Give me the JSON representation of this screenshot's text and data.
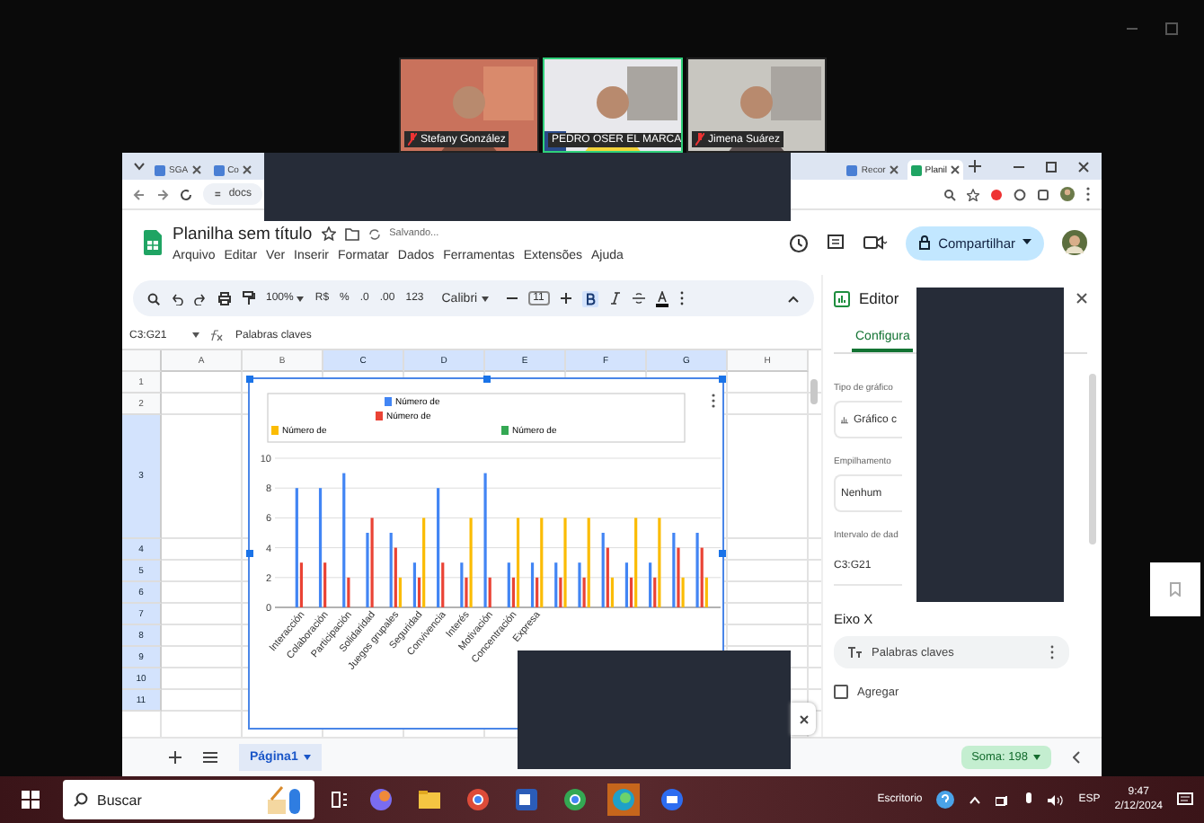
{
  "meeting": {
    "participants": [
      {
        "name": "Stefany González",
        "muted": true,
        "selected": false
      },
      {
        "name": "PEDRO OSER EL MARCA",
        "muted": false,
        "selected": true
      },
      {
        "name": "Jimena Suárez",
        "muted": true,
        "selected": false
      }
    ]
  },
  "browser": {
    "tabs": [
      {
        "label": "SGA",
        "selected": false
      },
      {
        "label": "Co",
        "selected": false
      },
      {
        "label": "Recor",
        "selected": false
      },
      {
        "label": "Planil",
        "selected": true
      }
    ],
    "address": "docs"
  },
  "sheet": {
    "title": "Planilha sem título",
    "status": "Salvando...",
    "menu": [
      "Arquivo",
      "Editar",
      "Ver",
      "Inserir",
      "Formatar",
      "Dados",
      "Ferramentas",
      "Extensões",
      "Ajuda"
    ],
    "share": "Compartilhar",
    "toolbar": [
      {
        "kind": "text",
        "text": "100%",
        "dropdown": true
      },
      {
        "kind": "text",
        "text": "R$"
      },
      {
        "kind": "text",
        "text": "%"
      },
      {
        "kind": "text",
        "text": ".0"
      },
      {
        "kind": "text",
        "text": ".00"
      },
      {
        "kind": "text",
        "text": "123"
      },
      {
        "kind": "font",
        "text": "Calibri",
        "dropdown": true
      },
      {
        "kind": "size",
        "text": "11"
      }
    ],
    "name_box": "C3:G21",
    "formula": "Palabras claves",
    "columns": [
      {
        "label": "A",
        "selected": false
      },
      {
        "label": "B",
        "selected": false
      },
      {
        "label": "C",
        "selected": true
      },
      {
        "label": "D",
        "selected": true
      },
      {
        "label": "E",
        "selected": true
      },
      {
        "label": "F",
        "selected": true
      },
      {
        "label": "G",
        "selected": true
      },
      {
        "label": "H",
        "selected": false
      }
    ],
    "rows": [
      {
        "label": "1",
        "selected": false,
        "tall": false
      },
      {
        "label": "2",
        "selected": false,
        "tall": false
      },
      {
        "label": "3",
        "selected": true,
        "tall": true
      },
      {
        "label": "4",
        "selected": true,
        "tall": false
      },
      {
        "label": "5",
        "selected": true,
        "tall": false
      },
      {
        "label": "6",
        "selected": true,
        "tall": false
      },
      {
        "label": "7",
        "selected": true,
        "tall": false
      },
      {
        "label": "8",
        "selected": true,
        "tall": false
      },
      {
        "label": "9",
        "selected": true,
        "tall": false
      },
      {
        "label": "10",
        "selected": true,
        "tall": false
      },
      {
        "label": "11",
        "selected": true,
        "tall": false
      }
    ],
    "chart": {
      "chart_data": {
        "type": "bar",
        "categories": [
          "Interacción",
          "Colaboración",
          "Participación",
          "Solidaridad",
          "Juegos grupales",
          "Seguridad",
          "Convivencia",
          "Interés",
          "Motivación",
          "Concentración",
          "Expresa",
          null,
          null,
          null,
          null,
          null,
          null,
          null
        ],
        "ylim": [
          0,
          10
        ],
        "yticks": [
          0,
          2,
          4,
          6,
          8,
          10
        ],
        "grid": true,
        "series": [
          {
            "name": "Número de",
            "color": "#4285f4",
            "values": [
              8,
              8,
              9,
              5,
              5,
              3,
              8,
              3,
              9,
              3,
              3,
              3,
              3,
              5,
              3,
              3,
              5,
              5
            ]
          },
          {
            "name": "Número de",
            "color": "#ea4335",
            "values": [
              3,
              3,
              2,
              6,
              4,
              2,
              3,
              2,
              2,
              2,
              2,
              2,
              2,
              4,
              2,
              2,
              4,
              4
            ]
          },
          {
            "name": "Número de",
            "color": "#fbbc04",
            "values": [
              null,
              null,
              null,
              null,
              2,
              6,
              null,
              6,
              null,
              6,
              6,
              6,
              6,
              2,
              6,
              6,
              2,
              2
            ]
          },
          {
            "name": "Número de",
            "color": "#34a853",
            "values": [
              null,
              null,
              null,
              null,
              null,
              null,
              null,
              null,
              null,
              null,
              null,
              null,
              null,
              null,
              null,
              null,
              null,
              null
            ]
          }
        ]
      }
    },
    "sheet_tabs": [
      {
        "label": "Página1",
        "selected": true
      }
    ],
    "sum": "Soma: 198"
  },
  "editor": {
    "title": "Editor",
    "tab": "Configura",
    "fields": [
      {
        "label": "Tipo de gráfico",
        "value": "Gráfico c",
        "kind": "chart"
      },
      {
        "label": "Empilhamento",
        "value": "Nenhum",
        "kind": "plain"
      },
      {
        "label": "Intervalo de dad",
        "value": "C3:G21",
        "kind": "range"
      }
    ],
    "x_axis": {
      "heading": "Eixo X",
      "value": "Palabras claves"
    },
    "aggregate": {
      "label": "Agregar",
      "checked": false
    }
  },
  "taskbar": {
    "search": "Buscar",
    "desktop": "Escritorio",
    "language": "ESP",
    "time": "9:47",
    "date": "2/12/2024"
  }
}
